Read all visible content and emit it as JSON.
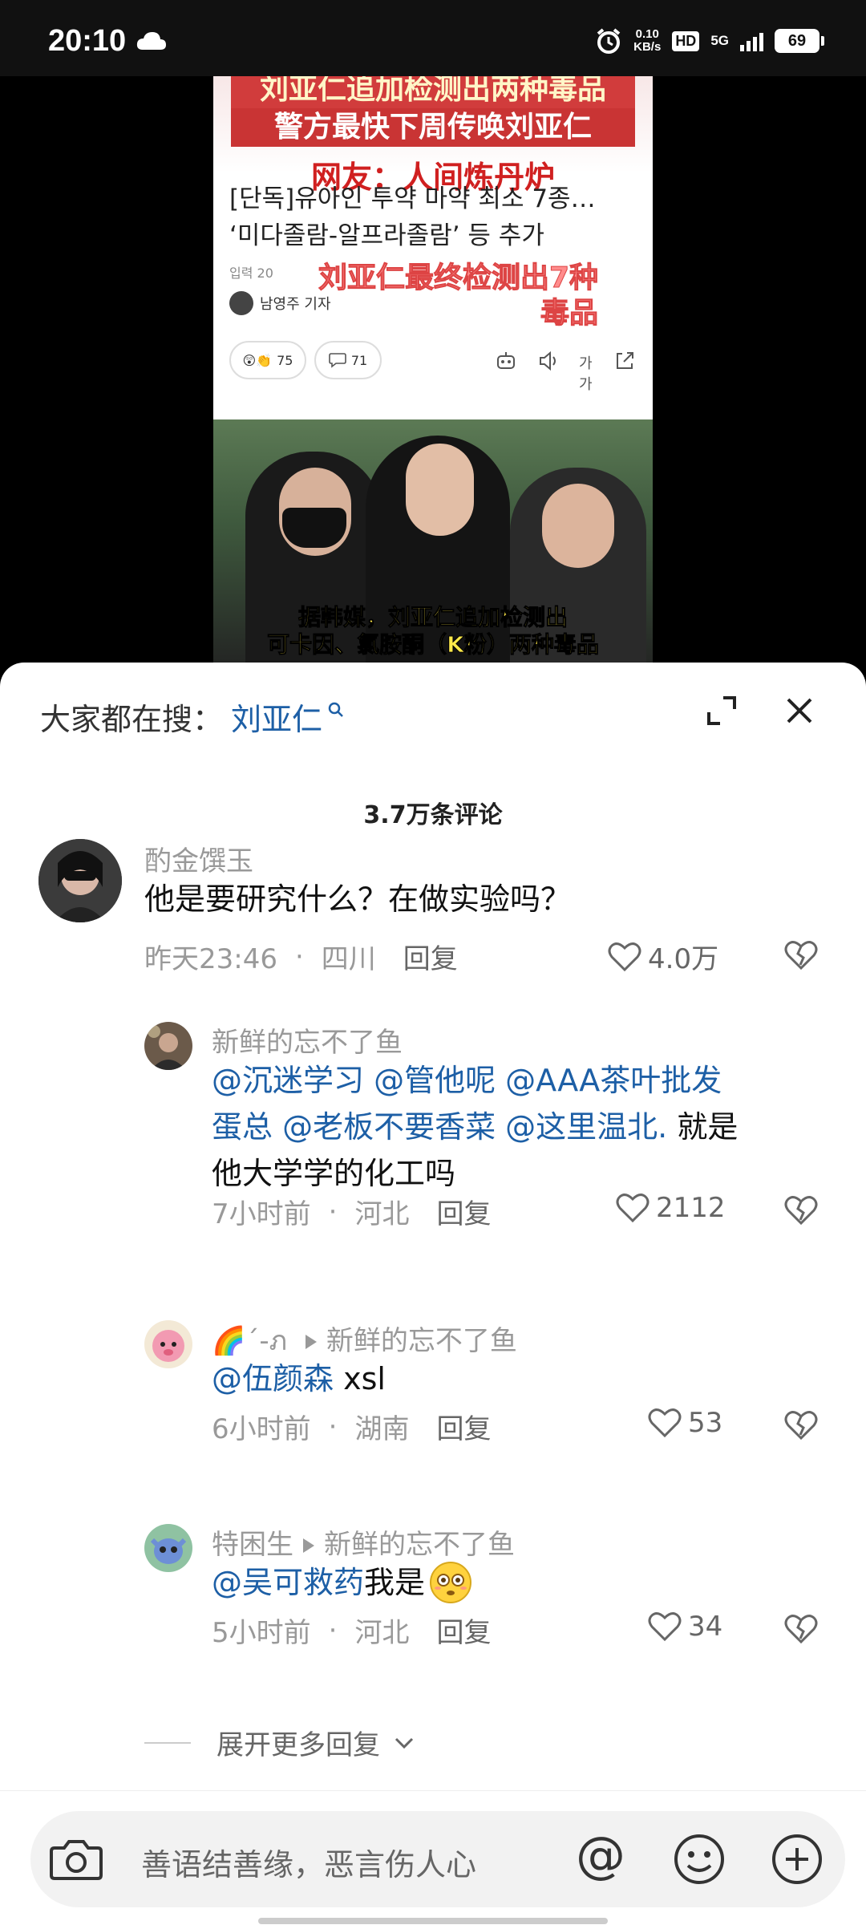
{
  "status_bar": {
    "time": "20:10",
    "net_speed_value": "0.10",
    "net_speed_unit": "KB/s",
    "hd": "HD",
    "network": "5G",
    "battery": "69"
  },
  "video": {
    "headline_line1": "刘亚仁追加检测出两种毒品",
    "headline_line2": "警方最快下周传唤刘亚仁",
    "headline_line3": "网友：人间炼丹炉",
    "article_title_line1": "[단독]유아인 투약 마약 최소 7종…",
    "article_title_line2": "‘미다졸람-알프라졸람’ 등 추가",
    "article_meta": "입력 20",
    "article_author": "남영주 기자",
    "overlay_line1": "刘亚仁最终检测出7种",
    "overlay_line2": "毒品",
    "likes_count": "75",
    "comments_count": "71",
    "font_size_label": "가가",
    "subtitle_line1": "据韩媒，刘亚仁追加检测出",
    "subtitle_line2": "可卡因、氯胺酮（K粉）两种毒品"
  },
  "sheet": {
    "search_prefix": "大家都在搜：",
    "search_keyword": "刘亚仁",
    "comment_count": "3.7万条评论",
    "reply_label": "回复",
    "more_replies": "展开更多回复"
  },
  "comments": [
    {
      "author": "酌金馔玉",
      "text": "他是要研究什么？在做实验吗？",
      "time": "昨天23:46",
      "location": "四川",
      "likes": "4.0万"
    },
    {
      "author": "新鲜的忘不了鱼",
      "mentions_line1": "@沉迷学习 @管他呢 @AAA茶叶批发",
      "mentions_line2": "蛋总 @老板不要香菜 @这里温北.",
      "text_tail": " 就是",
      "text_line3": "他大学学的化工吗",
      "time": "7小时前",
      "location": "河北",
      "likes": "2112"
    },
    {
      "author": "🌈´-ภ ",
      "reply_to": "新鲜的忘不了鱼",
      "mention": "@伍颜森",
      "text": " xsl",
      "time": "6小时前",
      "location": "湖南",
      "likes": "53"
    },
    {
      "author": "特困生",
      "reply_to": "新鲜的忘不了鱼",
      "mention": "@吴可救药",
      "text": " 我是",
      "time": "5小时前",
      "location": "河北",
      "likes": "34"
    }
  ],
  "input": {
    "placeholder": "善语结善缘，恶言伤人心",
    "at_symbol": "@"
  }
}
